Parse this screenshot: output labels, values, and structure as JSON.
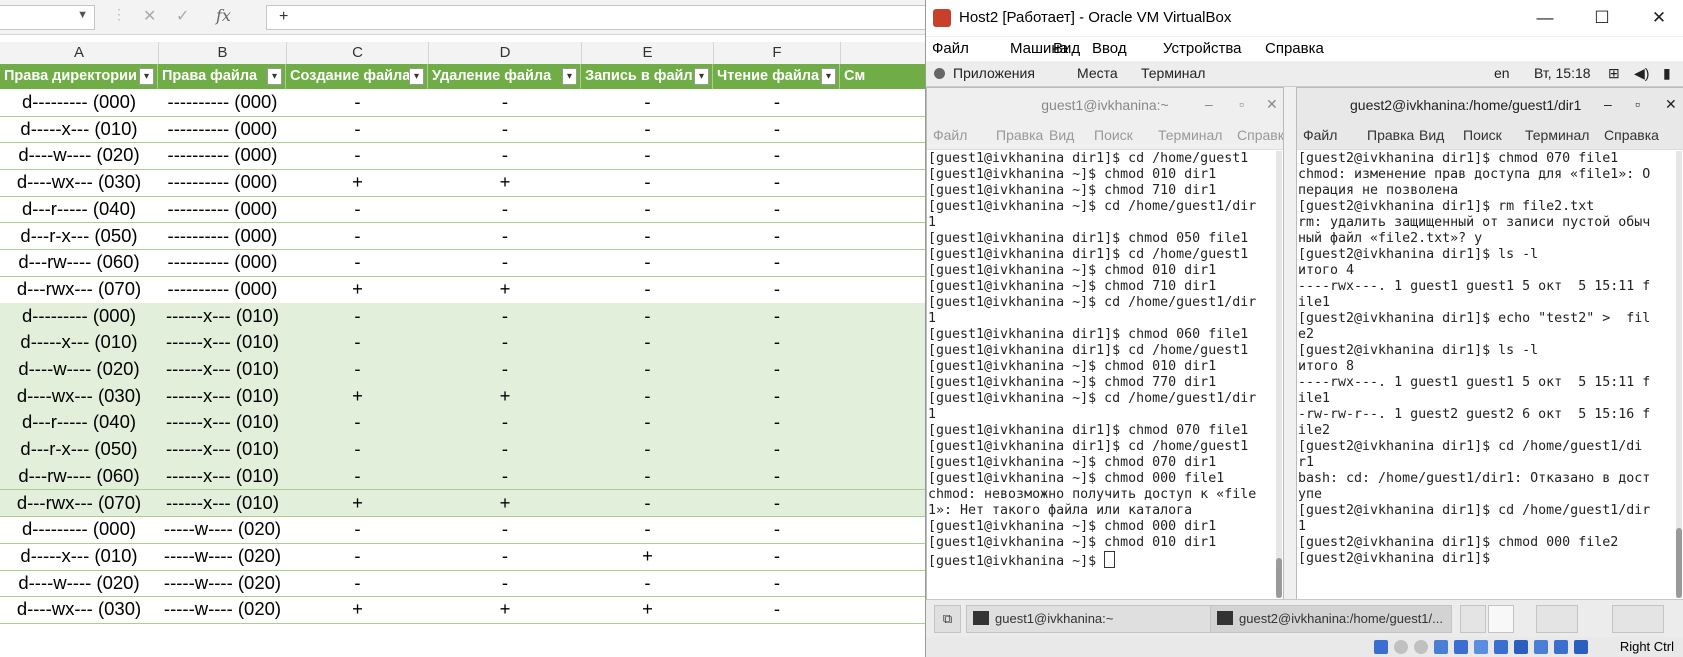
{
  "excel": {
    "formula_bar": {
      "cancel_glyph": "✕",
      "enter_glyph": "✓",
      "fx_label": "fx",
      "formula_value": "+"
    },
    "column_letters": [
      "A",
      "B",
      "C",
      "D",
      "E",
      "F"
    ],
    "table_headers": [
      "Права директории",
      "Права файла",
      "Создание файла",
      "Удаление файла",
      "Запись в файл",
      "Чтение файла",
      "См"
    ],
    "rows": [
      [
        "d--------- (000)",
        "---------- (000)",
        "-",
        "-",
        "-",
        "-"
      ],
      [
        "d-----x--- (010)",
        "---------- (000)",
        "-",
        "-",
        "-",
        "-"
      ],
      [
        "d----w---- (020)",
        "---------- (000)",
        "-",
        "-",
        "-",
        "-"
      ],
      [
        "d----wx--- (030)",
        "---------- (000)",
        "+",
        "+",
        "-",
        "-"
      ],
      [
        "d---r----- (040)",
        "---------- (000)",
        "-",
        "-",
        "-",
        "-"
      ],
      [
        "d---r-x--- (050)",
        "---------- (000)",
        "-",
        "-",
        "-",
        "-"
      ],
      [
        "d---rw---- (060)",
        "---------- (000)",
        "-",
        "-",
        "-",
        "-"
      ],
      [
        "d---rwx--- (070)",
        "---------- (000)",
        "+",
        "+",
        "-",
        "-"
      ],
      [
        "d--------- (000)",
        "------x--- (010)",
        "-",
        "-",
        "-",
        "-"
      ],
      [
        "d-----x--- (010)",
        "------x--- (010)",
        "-",
        "-",
        "-",
        "-"
      ],
      [
        "d----w---- (020)",
        "------x--- (010)",
        "-",
        "-",
        "-",
        "-"
      ],
      [
        "d----wx--- (030)",
        "------x--- (010)",
        "+",
        "+",
        "-",
        "-"
      ],
      [
        "d---r----- (040)",
        "------x--- (010)",
        "-",
        "-",
        "-",
        "-"
      ],
      [
        "d---r-x--- (050)",
        "------x--- (010)",
        "-",
        "-",
        "-",
        "-"
      ],
      [
        "d---rw---- (060)",
        "------x--- (010)",
        "-",
        "-",
        "-",
        "-"
      ],
      [
        "d---rwx--- (070)",
        "------x--- (010)",
        "+",
        "+",
        "-",
        "-"
      ],
      [
        "d--------- (000)",
        "-----w---- (020)",
        "-",
        "-",
        "-",
        "-"
      ],
      [
        "d-----x--- (010)",
        "-----w---- (020)",
        "-",
        "-",
        "+",
        "-"
      ],
      [
        "d----w---- (020)",
        "-----w---- (020)",
        "-",
        "-",
        "-",
        "-"
      ],
      [
        "d----wx--- (030)",
        "-----w---- (020)",
        "+",
        "+",
        "+",
        "-"
      ]
    ],
    "colors": {
      "header_green": "#70ad47",
      "band_green": "#e2efda"
    }
  },
  "vbox": {
    "title": "Host2 [Работает] - Oracle VM VirtualBox",
    "menu": [
      "Файл",
      "Машина",
      "Вид",
      "Ввод",
      "Устройства",
      "Справка"
    ],
    "guest_panel": {
      "items": [
        "Приложения",
        "Места",
        "Терминал"
      ],
      "lang": "en",
      "clock": "Вт, 15:18"
    },
    "term1": {
      "title": "guest1@ivkhanina:~",
      "menu": [
        "Файл",
        "Правка",
        "Вид",
        "Поиск",
        "Терминал",
        "Справка"
      ],
      "lines": [
        "[guest1@ivkhanina dir1]$ cd /home/guest1",
        "[guest1@ivkhanina ~]$ chmod 010 dir1",
        "[guest1@ivkhanina ~]$ chmod 710 dir1",
        "[guest1@ivkhanina ~]$ cd /home/guest1/dir",
        "1",
        "[guest1@ivkhanina dir1]$ chmod 050 file1",
        "[guest1@ivkhanina dir1]$ cd /home/guest1",
        "[guest1@ivkhanina ~]$ chmod 010 dir1",
        "[guest1@ivkhanina ~]$ chmod 710 dir1",
        "[guest1@ivkhanina ~]$ cd /home/guest1/dir",
        "1",
        "[guest1@ivkhanina dir1]$ chmod 060 file1",
        "[guest1@ivkhanina dir1]$ cd /home/guest1",
        "[guest1@ivkhanina ~]$ chmod 010 dir1",
        "[guest1@ivkhanina ~]$ chmod 770 dir1",
        "[guest1@ivkhanina ~]$ cd /home/guest1/dir",
        "1",
        "[guest1@ivkhanina dir1]$ chmod 070 file1",
        "[guest1@ivkhanina dir1]$ cd /home/guest1",
        "[guest1@ivkhanina ~]$ chmod 070 dir1",
        "[guest1@ivkhanina ~]$ chmod 000 file1",
        "chmod: невозможно получить доступ к «file",
        "1»: Нет такого файла или каталога",
        "[guest1@ivkhanina ~]$ chmod 000 dir1",
        "[guest1@ivkhanina ~]$ chmod 010 dir1",
        "[guest1@ivkhanina ~]$ "
      ]
    },
    "term2": {
      "title": "guest2@ivkhanina:/home/guest1/dir1",
      "menu": [
        "Файл",
        "Правка",
        "Вид",
        "Поиск",
        "Терминал",
        "Справка"
      ],
      "lines": [
        "[guest2@ivkhanina dir1]$ chmod 070 file1",
        "chmod: изменение прав доступа для «file1»: О",
        "перация не позволена",
        "[guest2@ivkhanina dir1]$ rm file2.txt",
        "rm: удалить защищенный от записи пустой обыч",
        "ный файл «file2.txt»? y",
        "[guest2@ivkhanina dir1]$ ls -l",
        "итого 4",
        "----rwx---. 1 guest1 guest1 5 окт  5 15:11 f",
        "ile1",
        "[guest2@ivkhanina dir1]$ echo \"test2\" >  fil",
        "e2",
        "[guest2@ivkhanina dir1]$ ls -l",
        "итого 8",
        "----rwx---. 1 guest1 guest1 5 окт  5 15:11 f",
        "ile1",
        "-rw-rw-r--. 1 guest2 guest2 6 окт  5 15:16 f",
        "ile2",
        "[guest2@ivkhanina dir1]$ cd /home/guest1/di",
        "r1",
        "bash: cd: /home/guest1/dir1: Отказано в дост",
        "упе",
        "[guest2@ivkhanina dir1]$ cd /home/guest1/dir",
        "1",
        "[guest2@ivkhanina dir1]$ chmod 000 file2",
        "[guest2@ivkhanina dir1]$ "
      ]
    },
    "taskbar": {
      "task1": "guest1@ivkhanina:~",
      "task2": "guest2@ivkhanina:/home/guest1/..."
    },
    "host_key": "Right Ctrl"
  }
}
